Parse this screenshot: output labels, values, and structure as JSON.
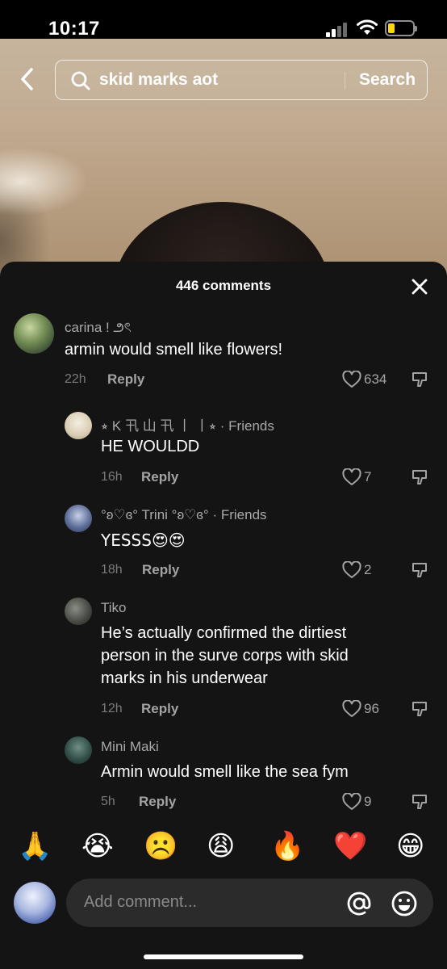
{
  "status_bar": {
    "time": "10:17"
  },
  "search": {
    "query": "skid marks aot",
    "action_label": "Search"
  },
  "comments_sheet": {
    "title": "446 comments"
  },
  "comments": [
    {
      "username": "carina ! ౨ৎ",
      "text": "armin would smell like flowers!",
      "time": "22h",
      "reply_label": "Reply",
      "likes": "634"
    },
    {
      "username": "⭒ K 卂 山 卂 丨 丨⭒",
      "friend_tag": "· Friends",
      "text": "HE WOULDD",
      "time": "16h",
      "reply_label": "Reply",
      "likes": "7"
    },
    {
      "username": "°ʚ♡ɞ° Trini °ʚ♡ɞ°",
      "friend_tag": "· Friends",
      "text": "YESSS😍😍",
      "time": "18h",
      "reply_label": "Reply",
      "likes": "2"
    },
    {
      "username": "Tiko",
      "text": "He’s actually confirmed the dirtiest person in the surve corps with skid marks in his underwear",
      "time": "12h",
      "reply_label": "Reply",
      "likes": "96"
    },
    {
      "username": "Mini Maki",
      "text": "Armin would smell like the sea fym",
      "time": "5h",
      "reply_label": "Reply",
      "likes": "9"
    }
  ],
  "emoji_bar": [
    "🙏",
    "😭",
    "☹️",
    "😩",
    "🔥",
    "❤️",
    "😁"
  ],
  "comment_input": {
    "placeholder": "Add comment..."
  },
  "colors": {
    "sheet_bg": "#141414",
    "input_bg": "#2b2b2b",
    "muted_text": "#a4a4a4",
    "battery": "#ffd60a"
  },
  "icons": [
    "back-chevron-icon",
    "search-icon",
    "close-icon",
    "heart-icon",
    "dislike-icon",
    "at-icon",
    "emoji-icon"
  ]
}
